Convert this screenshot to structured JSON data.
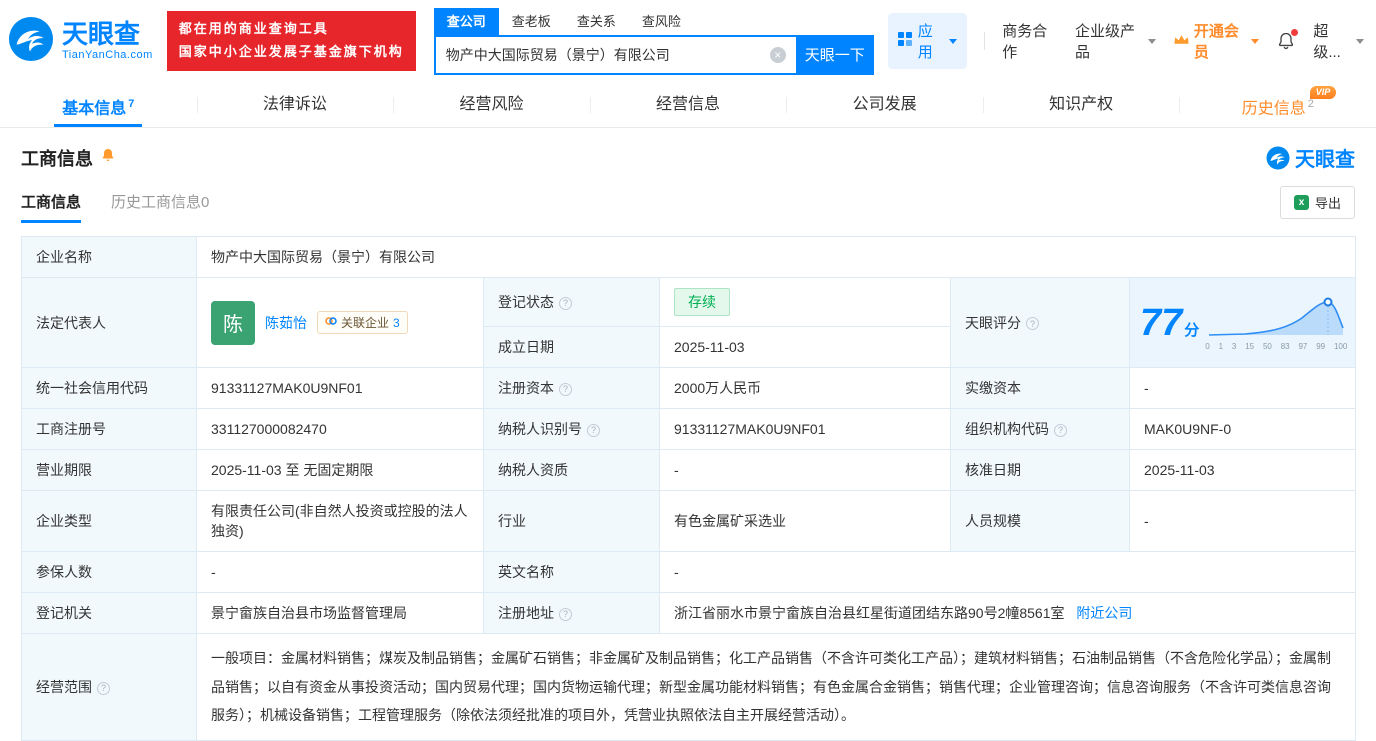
{
  "header": {
    "logo_title": "天眼查",
    "logo_subtitle": "TianYanCha.com",
    "promo_line1": "都在用的商业查询工具",
    "promo_line2": "国家中小企业发展子基金旗下机构",
    "search_tabs": [
      {
        "label": "查公司"
      },
      {
        "label": "查老板"
      },
      {
        "label": "查关系"
      },
      {
        "label": "查风险"
      }
    ],
    "search_value": "物产中大国际贸易（景宁）有限公司",
    "search_button": "天眼一下",
    "apps_label": "应用",
    "link_cooperation": "商务合作",
    "link_enterprise": "企业级产品",
    "vip_label": "开通会员",
    "username": "超级..."
  },
  "nav": {
    "vip_badge": "VIP",
    "tabs": [
      {
        "label": "基本信息",
        "count": "7"
      },
      {
        "label": "法律诉讼"
      },
      {
        "label": "经营风险"
      },
      {
        "label": "经营信息"
      },
      {
        "label": "公司发展"
      },
      {
        "label": "知识产权"
      },
      {
        "label": "历史信息",
        "count": "2"
      }
    ]
  },
  "section": {
    "title": "工商信息",
    "brand": "天眼查",
    "tab_current": "工商信息",
    "tab_history": "历史工商信息0",
    "export_label": "导出"
  },
  "score": {
    "label": "天眼评分",
    "value": "77",
    "unit": "分",
    "axis": [
      "0",
      "1",
      "3",
      "15",
      "50",
      "83",
      "97",
      "99",
      "100"
    ]
  },
  "fields": {
    "company_name": {
      "label": "企业名称",
      "value": "物产中大国际贸易（景宁）有限公司"
    },
    "legal_rep": {
      "label": "法定代表人",
      "name": "陈茹怡",
      "avatar": "陈",
      "related_label": "关联企业",
      "related_count": "3"
    },
    "reg_status": {
      "label": "登记状态",
      "value": "存续"
    },
    "establish_date": {
      "label": "成立日期",
      "value": "2025-11-03"
    },
    "credit_code": {
      "label": "统一社会信用代码",
      "value": "91331127MAK0U9NF01"
    },
    "reg_capital": {
      "label": "注册资本",
      "value": "2000万人民币"
    },
    "paid_capital": {
      "label": "实缴资本",
      "value": "-"
    },
    "reg_number": {
      "label": "工商注册号",
      "value": "331127000082470"
    },
    "taxpayer_id": {
      "label": "纳税人识别号",
      "value": "91331127MAK0U9NF01"
    },
    "org_code": {
      "label": "组织机构代码",
      "value": "MAK0U9NF-0"
    },
    "business_term": {
      "label": "营业期限",
      "value": "2025-11-03 至 无固定期限"
    },
    "taxpayer_qual": {
      "label": "纳税人资质",
      "value": "-"
    },
    "approval_date": {
      "label": "核准日期",
      "value": "2025-11-03"
    },
    "company_type": {
      "label": "企业类型",
      "value": "有限责任公司(非自然人投资或控股的法人独资)"
    },
    "industry": {
      "label": "行业",
      "value": "有色金属矿采选业"
    },
    "staff_size": {
      "label": "人员规模",
      "value": "-"
    },
    "insured_count": {
      "label": "参保人数",
      "value": "-"
    },
    "english_name": {
      "label": "英文名称",
      "value": "-"
    },
    "reg_authority": {
      "label": "登记机关",
      "value": "景宁畲族自治县市场监督管理局"
    },
    "reg_address": {
      "label": "注册地址",
      "value": "浙江省丽水市景宁畲族自治县红星街道团结东路90号2幢8561室",
      "link": "附近公司"
    },
    "business_scope": {
      "label": "经营范围",
      "value": "一般项目：金属材料销售；煤炭及制品销售；金属矿石销售；非金属矿及制品销售；化工产品销售（不含许可类化工产品）；建筑材料销售；石油制品销售（不含危险化学品）；金属制品销售；以自有资金从事投资活动；国内贸易代理；国内货物运输代理；新型金属功能材料销售；有色金属合金销售；销售代理；企业管理咨询；信息咨询服务（不含许可类信息咨询服务）；机械设备销售；工程管理服务（除依法须经批准的项目外，凭营业执照依法自主开展经营活动）。"
    }
  },
  "colors": {
    "brand_blue": "#0084ff",
    "vip_orange": "#ff8b2a",
    "promo_red": "#e7262c",
    "status_green": "#00af52"
  }
}
